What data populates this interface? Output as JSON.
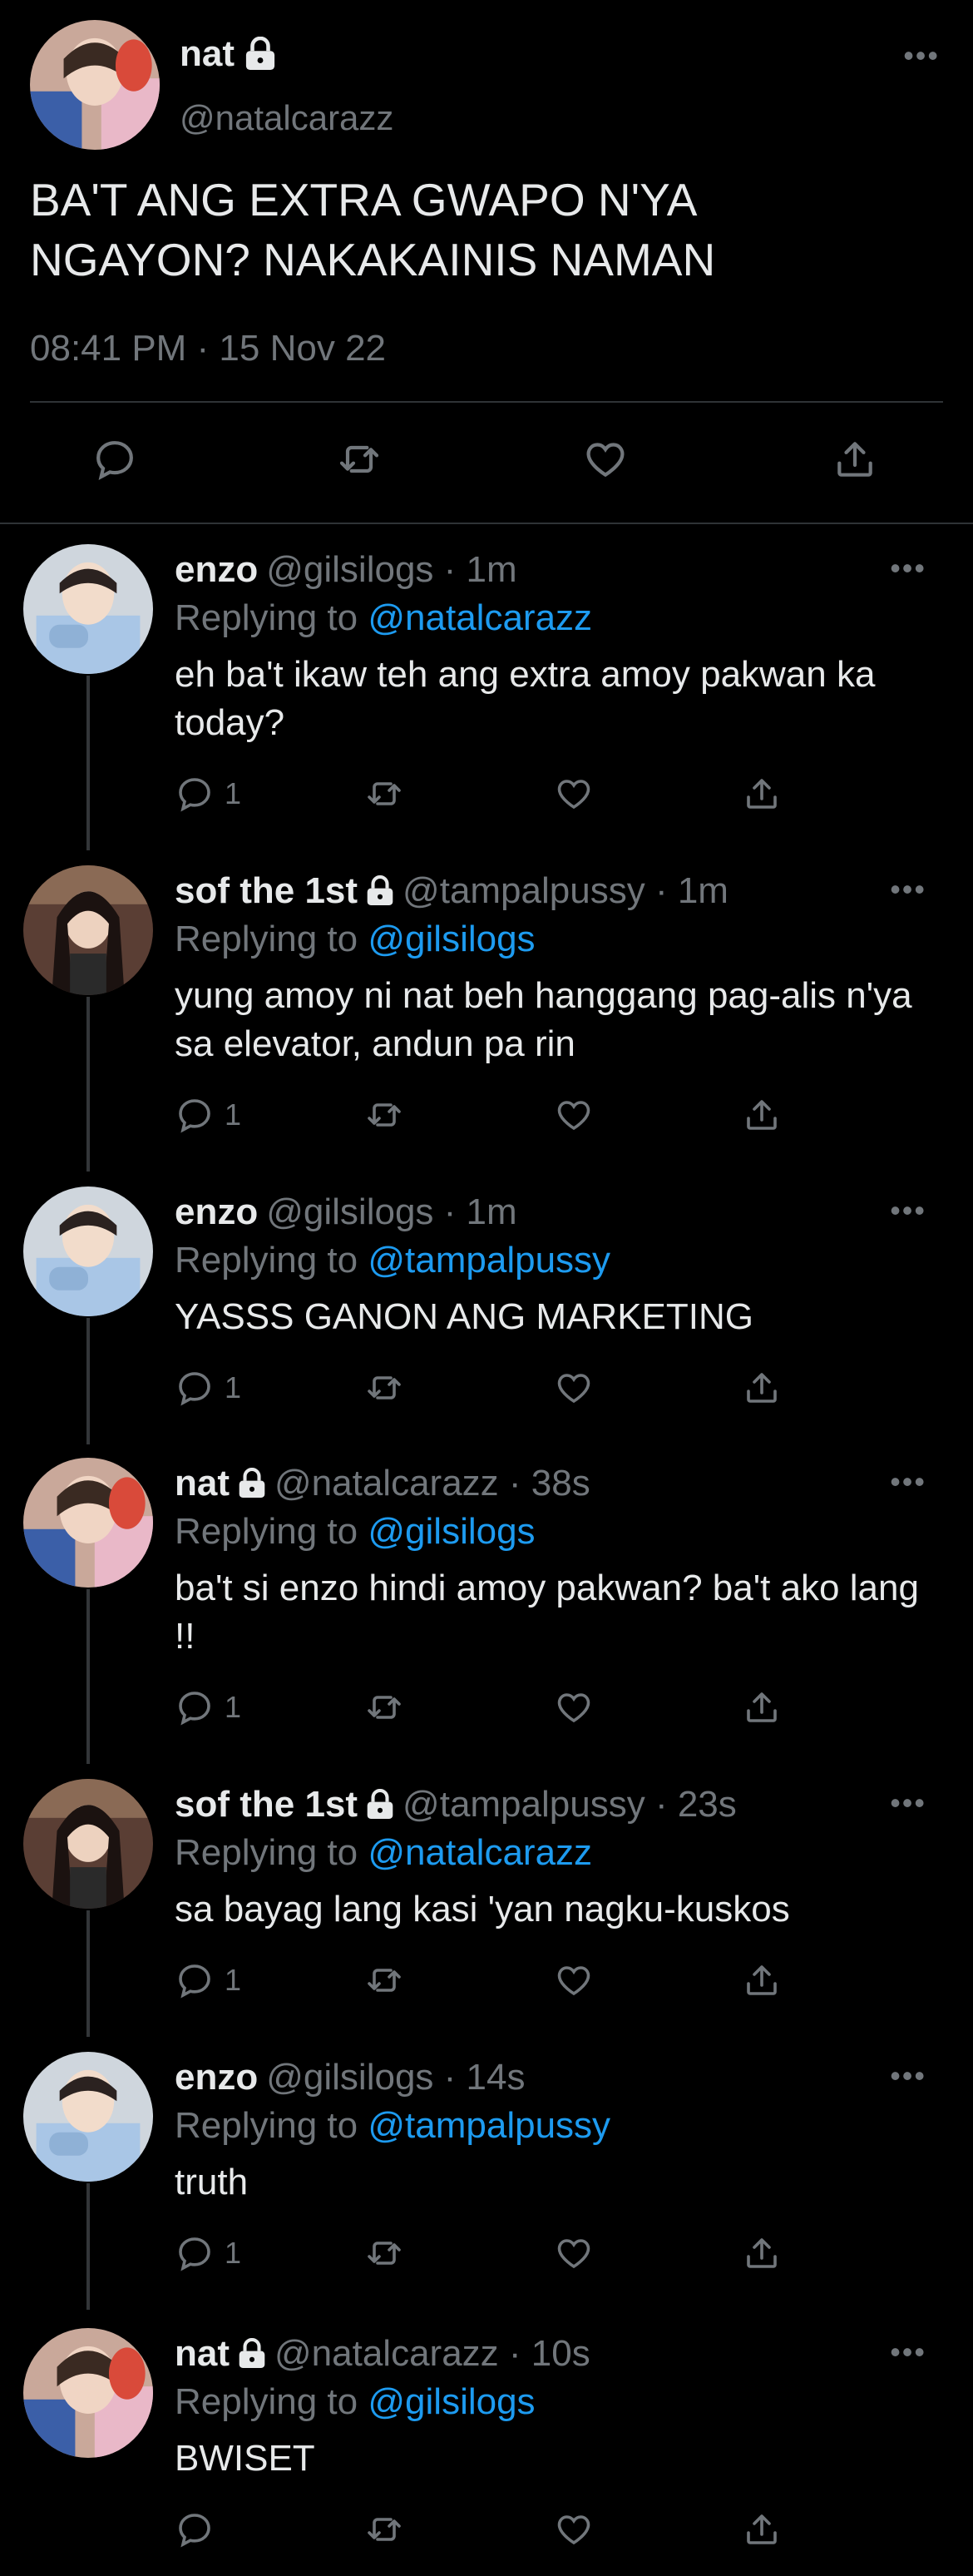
{
  "main_tweet": {
    "name": "nat",
    "handle": "@natalcarazz",
    "text_line1": "BA'T ANG EXTRA GWAPO N'YA",
    "text_line2": "NGAYON? NAKAKAINIS NAMAN",
    "timestamp": "08:41 PM · 15 Nov 22",
    "more_label": "•••",
    "actions": {
      "reply": "reply-icon",
      "retweet": "retweet-icon",
      "like": "heart-icon",
      "share": "share-icon"
    }
  },
  "replies": [
    {
      "name": "enzo",
      "locked": false,
      "meta": "@gilsilogs · 1m",
      "replying_prefix": "Replying to",
      "replying_to": "@natalcarazz",
      "text": "eh ba't ikaw teh ang extra amoy pakwan ka today?",
      "reply_count": "1",
      "avatar": "enzo"
    },
    {
      "name": "sof the 1st",
      "locked": true,
      "meta": "@tampalpussy · 1m",
      "replying_prefix": "Replying to",
      "replying_to": "@gilsilogs",
      "text": "yung amoy ni nat beh hanggang pag-alis n'ya sa elevator, andun pa rin",
      "reply_count": "1",
      "avatar": "sof"
    },
    {
      "name": "enzo",
      "locked": false,
      "meta": "@gilsilogs · 1m",
      "replying_prefix": "Replying to",
      "replying_to": "@tampalpussy",
      "text": "YASSS GANON ANG MARKETING",
      "reply_count": "1",
      "avatar": "enzo"
    },
    {
      "name": "nat",
      "locked": true,
      "meta": "@natalcarazz · 38s",
      "replying_prefix": "Replying to",
      "replying_to": "@gilsilogs",
      "text": "ba't si enzo hindi amoy pakwan? ba't ako lang !!",
      "reply_count": "1",
      "avatar": "nat"
    },
    {
      "name": "sof the 1st",
      "locked": true,
      "meta": "@tampalpussy · 23s",
      "replying_prefix": "Replying to",
      "replying_to": "@natalcarazz",
      "text": "sa bayag lang kasi 'yan nagku-kuskos",
      "reply_count": "1",
      "avatar": "sof"
    },
    {
      "name": "enzo",
      "locked": false,
      "meta": "@gilsilogs · 14s",
      "replying_prefix": "Replying to",
      "replying_to": "@tampalpussy",
      "text": "truth",
      "reply_count": "1",
      "avatar": "enzo"
    },
    {
      "name": "nat",
      "locked": true,
      "meta": "@natalcarazz · 10s",
      "replying_prefix": "Replying to",
      "replying_to": "@gilsilogs",
      "text": "BWISET",
      "reply_count": "",
      "avatar": "nat"
    }
  ],
  "colors": {
    "background": "#000000",
    "text": "#e7e9ea",
    "muted": "#71767b",
    "link": "#1d9bf0",
    "divider": "#2f3336"
  }
}
